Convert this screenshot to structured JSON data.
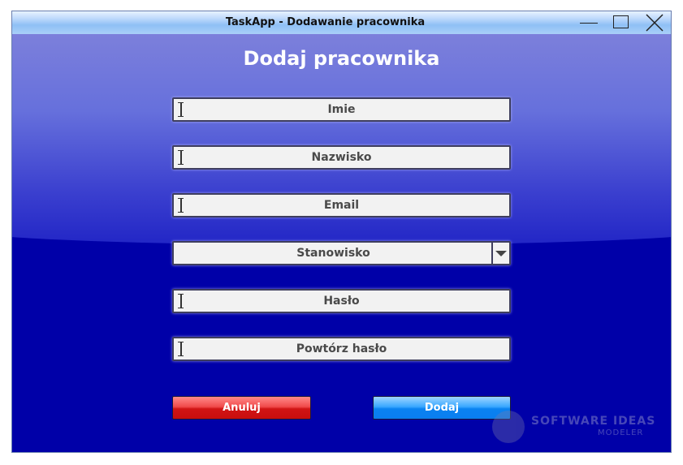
{
  "window": {
    "title": "TaskApp - Dodawanie pracownika"
  },
  "form": {
    "heading": "Dodaj pracownika",
    "fields": [
      {
        "placeholder": "Imie"
      },
      {
        "placeholder": "Nazwisko"
      },
      {
        "placeholder": "Email"
      },
      {
        "placeholder": "Stanowisko"
      },
      {
        "placeholder": "Hasło"
      },
      {
        "placeholder": "Powtórz hasło"
      }
    ],
    "cancel_label": "Anuluj",
    "add_label": "Dodaj"
  },
  "watermark": {
    "line1": "SOFTWARE IDEAS",
    "line2": "MODELER"
  },
  "icons": {
    "minimize": "minimize-icon",
    "maximize": "maximize-icon",
    "close": "close-icon",
    "dropdown": "chevron-down-icon",
    "text_cursor": "text-cursor-icon"
  },
  "colors": {
    "background": "#0000a8",
    "cancel": "#d01414",
    "add": "#0a82f0"
  }
}
